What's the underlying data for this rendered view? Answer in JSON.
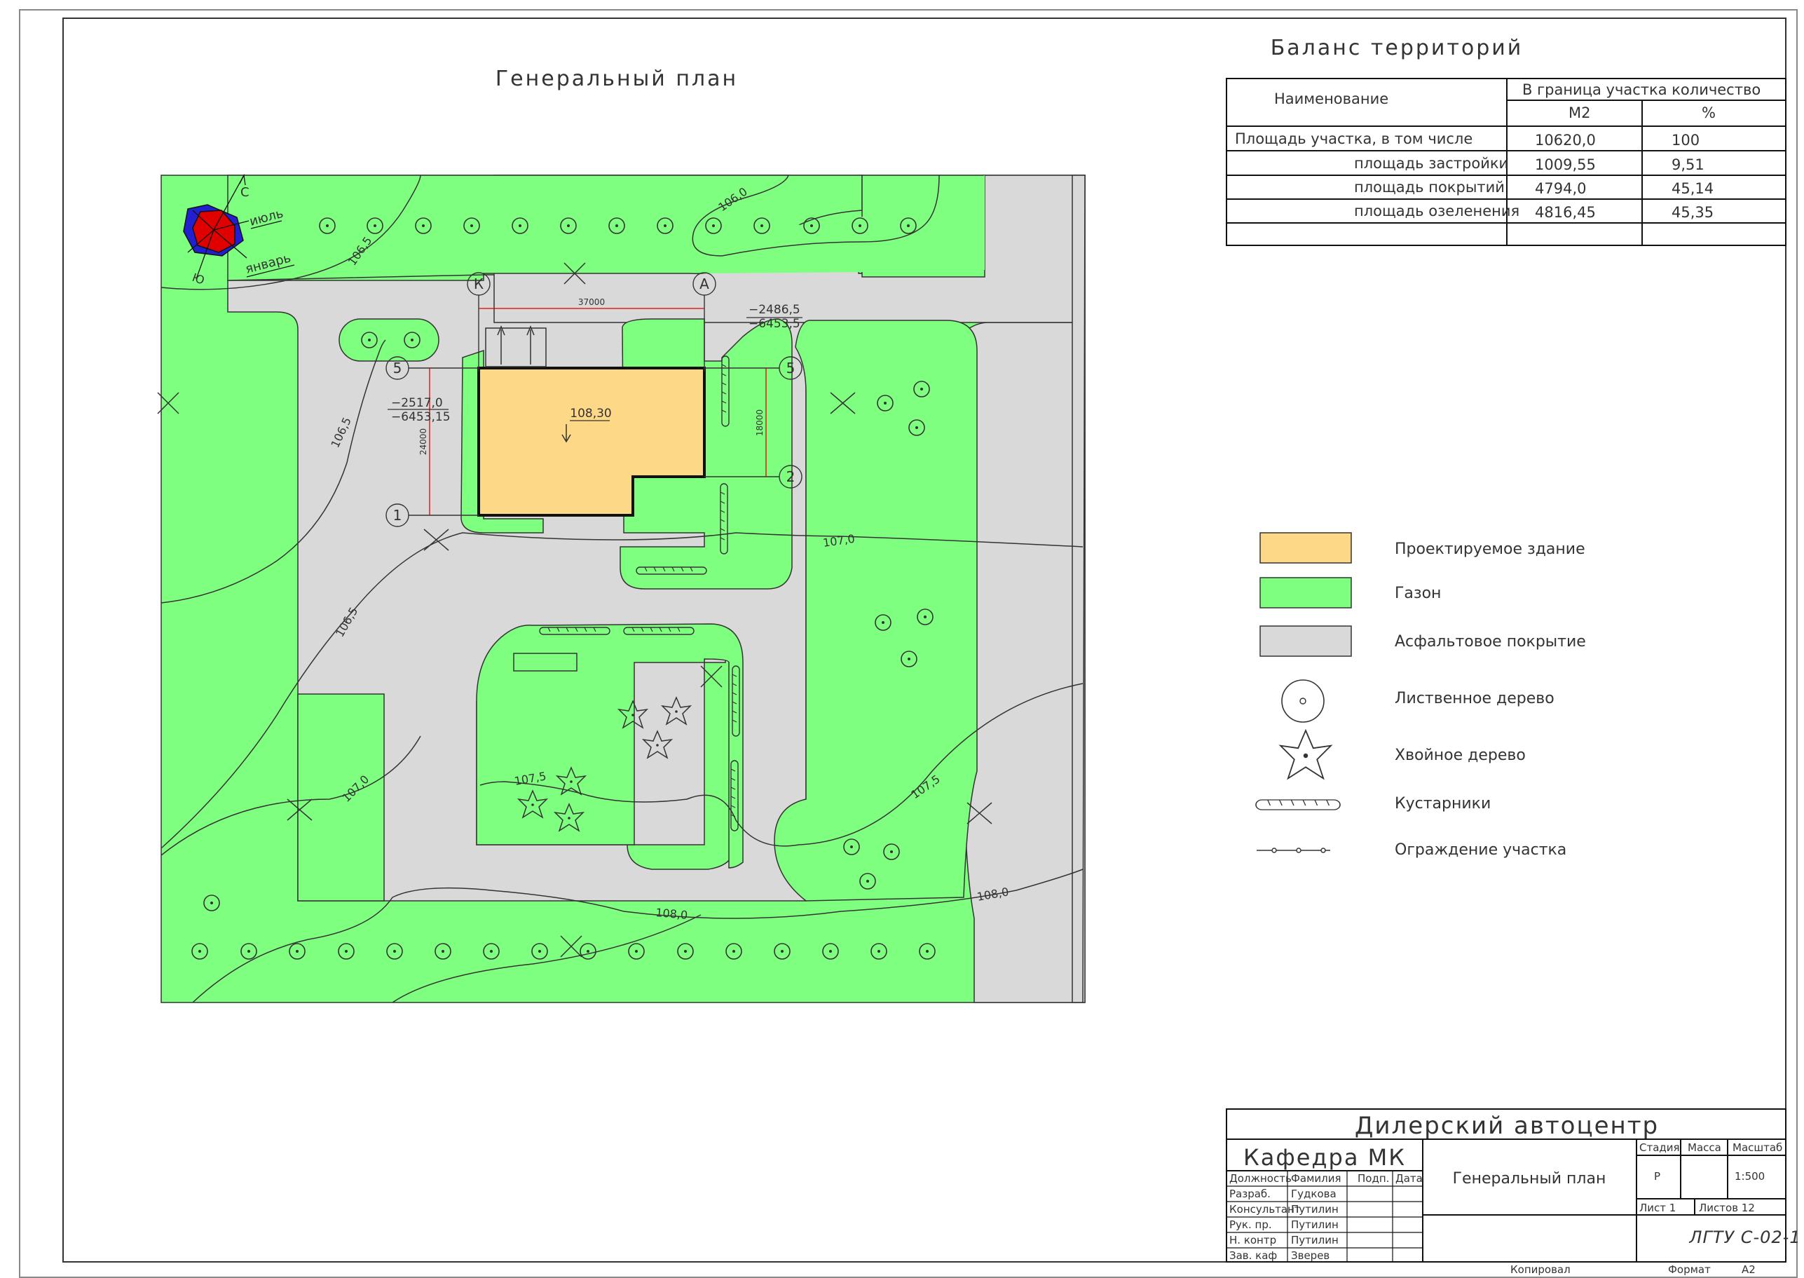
{
  "plan": {
    "title": "Генеральный план",
    "elevation_labels": [
      "106,0",
      "106,5",
      "106,5",
      "106,5",
      "107,0",
      "107,0",
      "107,5",
      "107,5",
      "108,0",
      "108,0",
      "106,0"
    ],
    "dimension_horizontal": "37000",
    "dimension_left": "24000",
    "dimension_right": "18000",
    "building_height": "108,30",
    "corner_top_right": [
      "−2486,5",
      "−6453,5"
    ],
    "corner_left": [
      "−2517,0",
      "−6453,15"
    ],
    "axes": {
      "k": "К",
      "a": "А",
      "five_left": "5",
      "five_right": "5",
      "one": "1",
      "two": "2"
    },
    "wind_rose": {
      "north": "С",
      "south": "Ю",
      "july": "июль",
      "january": "январь"
    }
  },
  "balance": {
    "title": "Баланс территорий",
    "headers": {
      "name": "Наименование",
      "group": "В граница участка количество",
      "m2": "М2",
      "percent": "%"
    },
    "rows": [
      {
        "name": "Площадь участка, в том числе",
        "m2": "10620,0",
        "percent": "100"
      },
      {
        "name": "площадь застройки",
        "m2": "1009,55",
        "percent": "9,51"
      },
      {
        "name": "площадь покрытий",
        "m2": "4794,0",
        "percent": "45,14"
      },
      {
        "name": "площадь озеленения",
        "m2": "4816,45",
        "percent": "45,35"
      }
    ]
  },
  "legend": [
    {
      "key": "building",
      "label": "Проектируемое здание",
      "color": "#FDD887"
    },
    {
      "key": "lawn",
      "label": "Газон",
      "color": "#7FFF7F"
    },
    {
      "key": "asphalt",
      "label": "Асфальтовое покрытие",
      "color": "#D9D9D9"
    },
    {
      "key": "deciduous",
      "label": "Лиственное дерево"
    },
    {
      "key": "conifer",
      "label": "Хвойное дерево"
    },
    {
      "key": "shrubs",
      "label": "Кустарники"
    },
    {
      "key": "fence",
      "label": "Ограждение участка"
    }
  ],
  "stamp": {
    "project": "Дилерский автоцентр",
    "department": "Кафедра МК",
    "sheet_title": "Генеральный план",
    "cols": {
      "role": "Должность",
      "surname": "Фамилия",
      "sign": "Подп.",
      "date": "Дата"
    },
    "people": [
      {
        "role": "Разраб.",
        "name": "Гудкова"
      },
      {
        "role": "Консультант",
        "name": "Путилин"
      },
      {
        "role": "Рук. пр.",
        "name": "Путилин"
      },
      {
        "role": "Н. контр",
        "name": "Путилин"
      },
      {
        "role": "Зав. каф",
        "name": "Зверев"
      }
    ],
    "stage_label": "Стадия",
    "mass_label": "Масса",
    "scale_label": "Масштаб",
    "stage": "Р",
    "scale": "1:500",
    "sheet": "Лист 1",
    "sheets": "Листов 12",
    "code": "ЛГТУ С-02-1",
    "copied": "Копировал",
    "format_label": "Формат",
    "format": "А2"
  },
  "colors": {
    "lawn": "#7FFF7F",
    "asphalt": "#D9D9D9",
    "building": "#FDD887",
    "dim": "#E00000",
    "rose_red": "#E00000",
    "rose_blue": "#2020D0"
  }
}
